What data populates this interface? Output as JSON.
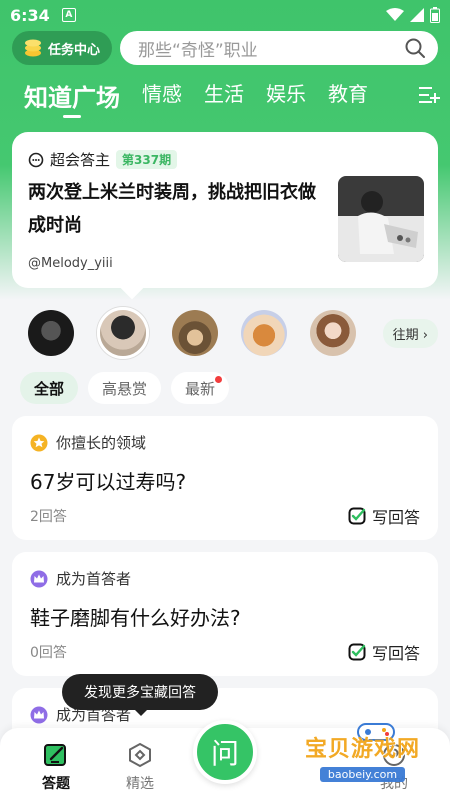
{
  "status": {
    "time": "6:34",
    "notif": "A"
  },
  "header": {
    "task_label": "任务中心",
    "search_placeholder": "那些“奇怪”职业"
  },
  "tabs": [
    {
      "label": "知道广场"
    },
    {
      "label": "情感"
    },
    {
      "label": "生活"
    },
    {
      "label": "娱乐"
    },
    {
      "label": "教育"
    }
  ],
  "feature": {
    "brand": "超会答主",
    "period": "第337期",
    "title": "两次登上米兰时装周，挑战把旧衣做成时尚",
    "user": "@Melody_yiii"
  },
  "past_label": "往期",
  "filters": [
    {
      "label": "全部"
    },
    {
      "label": "高悬赏"
    },
    {
      "label": "最新"
    }
  ],
  "questions": [
    {
      "tag": "你擅长的领域",
      "title": "67岁可以过寿吗?",
      "count": "2回答",
      "write": "写回答"
    },
    {
      "tag": "成为首答者",
      "title": "鞋子磨脚有什么好办法?",
      "count": "0回答",
      "write": "写回答"
    },
    {
      "tag": "成为首答者"
    }
  ],
  "tooltip": "发现更多宝藏回答",
  "nav": {
    "answer": "答题",
    "featured": "精选",
    "ask": "问",
    "mine": "我的"
  },
  "watermark": {
    "text": "宝贝游戏网",
    "url": "baobeiy.com"
  },
  "colors": {
    "brand_green": "#3fc46b",
    "ask_green": "#35c466",
    "badge_red": "#f23d3d"
  }
}
